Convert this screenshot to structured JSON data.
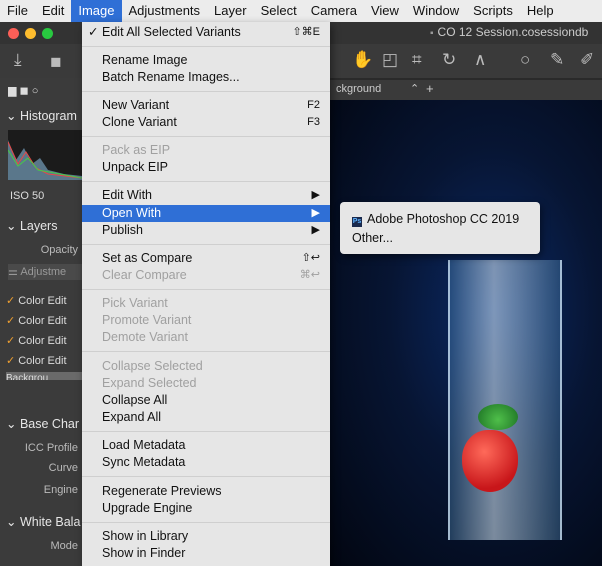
{
  "menubar": [
    "File",
    "Edit",
    "Image",
    "Adjustments",
    "Layer",
    "Select",
    "Camera",
    "View",
    "Window",
    "Scripts",
    "Help"
  ],
  "window_title": "CO 12 Session.cosessiondb",
  "toolbar_field": "ckground",
  "left_panel": {
    "histogram": "Histogram",
    "iso": "ISO 50",
    "layers": "Layers",
    "opacity": "Opacity",
    "adjustments": "Adjustme",
    "color_edits": [
      "Color Edit",
      "Color Edit",
      "Color Edit",
      "Color Edit"
    ],
    "background": "Backgrou",
    "base_char": "Base Char",
    "icc": "ICC Profile",
    "curve": "Curve",
    "engine": "Engine",
    "white_bal": "White Bala",
    "mode": "Mode"
  },
  "image_menu": {
    "edit_all": "Edit All Selected Variants",
    "edit_all_shortcut": "⇧⌘E",
    "rename": "Rename Image",
    "batch_rename": "Batch Rename Images...",
    "new_variant": "New Variant",
    "new_variant_sc": "F2",
    "clone_variant": "Clone Variant",
    "clone_variant_sc": "F3",
    "pack_eip": "Pack as EIP",
    "unpack_eip": "Unpack EIP",
    "edit_with": "Edit With",
    "open_with": "Open With",
    "publish": "Publish",
    "set_compare": "Set as Compare",
    "set_compare_sc": "⇧↩",
    "clear_compare": "Clear Compare",
    "clear_compare_sc": "⌘↩",
    "pick": "Pick Variant",
    "promote": "Promote Variant",
    "demote": "Demote Variant",
    "collapse_sel": "Collapse Selected",
    "expand_sel": "Expand Selected",
    "collapse_all": "Collapse All",
    "expand_all": "Expand All",
    "load_meta": "Load Metadata",
    "sync_meta": "Sync Metadata",
    "regen": "Regenerate Previews",
    "upgrade": "Upgrade Engine",
    "show_lib": "Show in Library",
    "show_finder": "Show in Finder"
  },
  "submenu": {
    "photoshop": "Adobe Photoshop CC 2019",
    "other": "Other..."
  }
}
